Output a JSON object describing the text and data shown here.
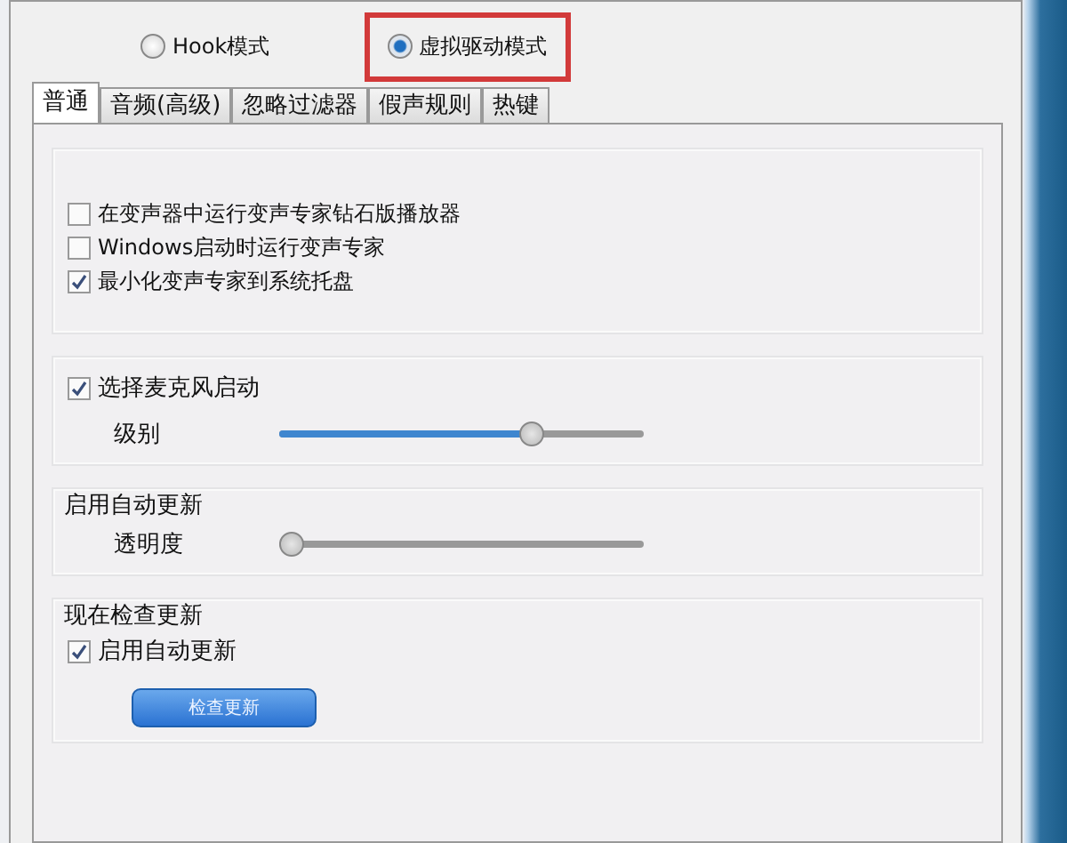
{
  "modes": [
    {
      "label": "Hook模式",
      "selected": false,
      "highlighted": false
    },
    {
      "label": "虚拟驱动模式",
      "selected": true,
      "highlighted": true
    }
  ],
  "tabs": [
    {
      "label": "普通",
      "selected": true
    },
    {
      "label": "音频(高级)",
      "selected": false
    },
    {
      "label": "忽略过滤器",
      "selected": false
    },
    {
      "label": "假声规则",
      "selected": false
    },
    {
      "label": "热键",
      "selected": false
    }
  ],
  "startup_group": {
    "options": [
      {
        "label": "在变声器中运行变声专家钻石版播放器",
        "checked": false
      },
      {
        "label": "Windows启动时运行变声专家",
        "checked": false
      },
      {
        "label": "最小化变声专家到系统托盘",
        "checked": true
      }
    ]
  },
  "mic_group": {
    "checkbox": {
      "label": "选择麦克风启动",
      "checked": true
    },
    "slider": {
      "label": "级别",
      "level": 0.69
    }
  },
  "update_group": {
    "title": "启用自动更新",
    "slider": {
      "label": "透明度",
      "level": 0
    }
  },
  "check_group": {
    "title": "现在检查更新",
    "checkbox": {
      "label": "启用自动更新",
      "checked": true
    },
    "button": "检查更新"
  }
}
